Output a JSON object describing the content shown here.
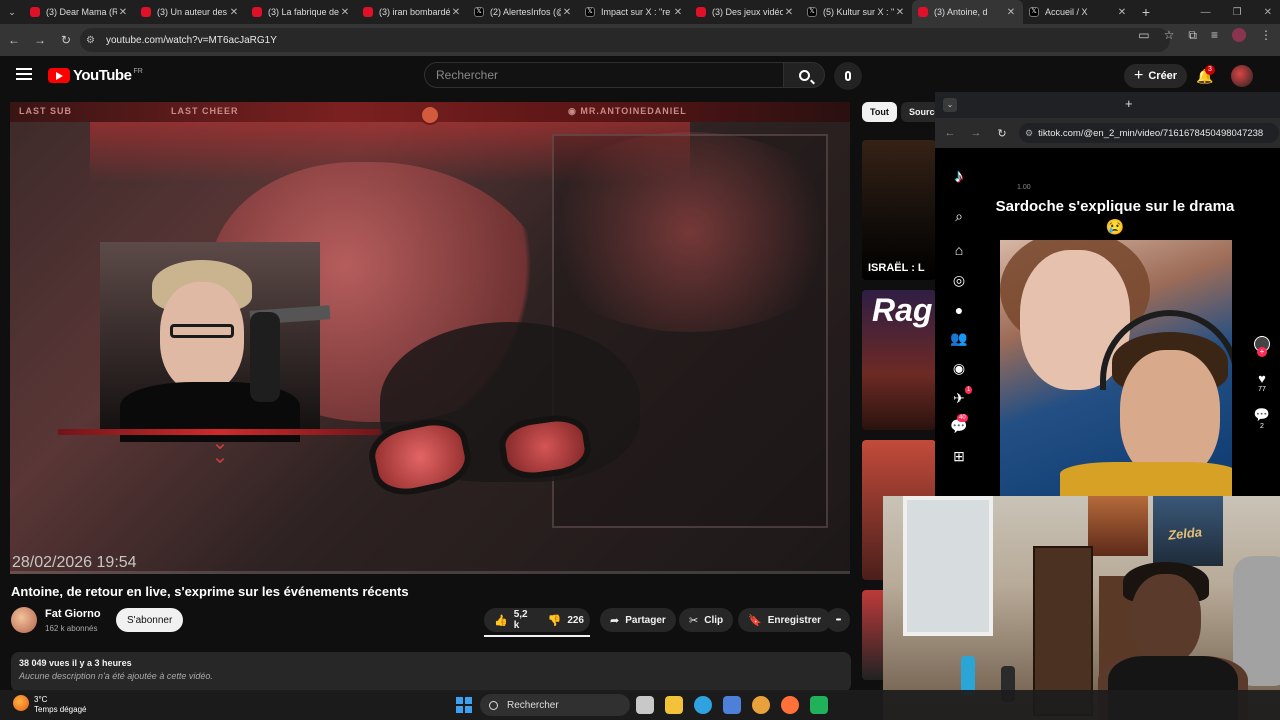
{
  "browser": {
    "tabs": [
      {
        "title": "(3) Dear Mama (R",
        "favicon": "youtube",
        "active": false
      },
      {
        "title": "(3) Un auteur des",
        "favicon": "youtube",
        "active": false
      },
      {
        "title": "(3) La fabrique de",
        "favicon": "youtube",
        "active": false
      },
      {
        "title": "(3) iran bombardé",
        "favicon": "youtube",
        "active": false
      },
      {
        "title": "(2) AlertesInfos (@",
        "favicon": "x",
        "active": false
      },
      {
        "title": "Impact sur X : \"re",
        "favicon": "x",
        "active": false
      },
      {
        "title": "(3) Des jeux vidéo",
        "favicon": "youtube",
        "active": false
      },
      {
        "title": "(5) Kultur sur X : \"",
        "favicon": "x",
        "active": false
      },
      {
        "title": "(3) Antoine, d",
        "favicon": "youtube",
        "active": true
      },
      {
        "title": "Accueil / X",
        "favicon": "x",
        "active": false
      }
    ],
    "close_glyph": "✕",
    "new_tab_glyph": "+",
    "url": "youtube.com/watch?v=MT6acJaRG1Y"
  },
  "youtube": {
    "logo_text": "YouTube",
    "country_code": "FR",
    "search_placeholder": "Rechercher",
    "create_label": "Créer",
    "create_plus": "+",
    "notifications_count": "3",
    "video": {
      "overlay_last_sub": "LAST SUB",
      "overlay_last_cheer": "LAST CHEER",
      "overlay_channel": "MR.ANTOINEDANIEL",
      "timestamp": "28/02/2026   19:54",
      "progress_fraction": 0.0
    },
    "title": "Antoine, de retour en live, s'exprime sur les événements récents",
    "channel": {
      "name": "Fat Giorno",
      "subscribers": "162 k abonnés",
      "subscribe_label": "S'abonner"
    },
    "actions": {
      "likes": "5,2 k",
      "dislikes": "226",
      "share_label": "Partager",
      "clip_label": "Clip",
      "save_label": "Enregistrer",
      "more_glyph": "•••"
    },
    "description": {
      "meta": "38 049 vues  il y a 3 heures",
      "text": "Aucune description n'a été ajoutée à cette vidéo."
    },
    "sidebar": {
      "chips": [
        "Tout",
        "Sources"
      ],
      "thumb1_caption": "ISRAËL : L",
      "thumb2_caption": "Rag"
    }
  },
  "tiktok_window": {
    "new_tab_glyph": "+",
    "url": "tiktok.com/@en_2_min/video/7161678450498047238",
    "caption": "Sardoche s'explique sur le drama 😢",
    "small_label": "1.00",
    "messages_badge": "1",
    "inbox_badge": "40",
    "likes_count": "77",
    "comments_count": "2"
  },
  "webcam": {
    "poster_text": "Zelda"
  },
  "taskbar": {
    "weather_temp": "3°C",
    "weather_desc": "Temps dégagé",
    "search_label": "Rechercher",
    "apps": [
      "task-view",
      "file-explorer",
      "edge",
      "store",
      "chrome",
      "firefox",
      "app-green"
    ],
    "app_colors": {
      "task-view": "#c8c8c8",
      "file-explorer": "#f3c13a",
      "edge": "#2fa3e0",
      "store": "#4e7fd9",
      "chrome": "#e9a23b",
      "firefox": "#ff7139",
      "app-green": "#1fb25a"
    }
  }
}
